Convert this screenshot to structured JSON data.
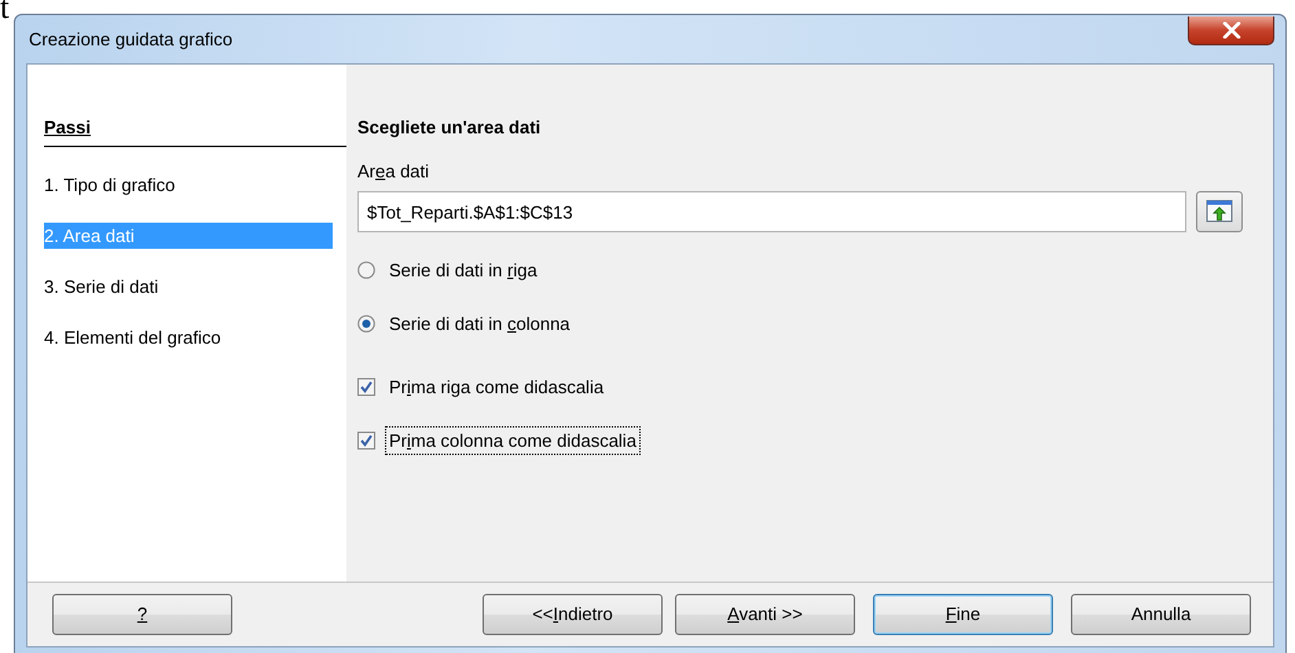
{
  "stray_text": "t",
  "window": {
    "title": "Creazione guidata grafico"
  },
  "steps": {
    "heading": "Passi",
    "items": [
      {
        "label": "1. Tipo di grafico",
        "selected": false
      },
      {
        "label": "2. Area dati",
        "selected": true
      },
      {
        "label": "3. Serie di dati",
        "selected": false
      },
      {
        "label": "4. Elementi del grafico",
        "selected": false
      }
    ]
  },
  "page": {
    "heading": "Scegliete un'area dati",
    "range_label": {
      "before": "Ar",
      "key": "e",
      "after": "a dati"
    },
    "range_value": "$Tot_Reparti.$A$1:$C$13",
    "options": [
      {
        "kind": "radio",
        "parts": {
          "before": "Serie di dati in ",
          "key": "r",
          "after": "iga"
        },
        "checked": false,
        "focused": false
      },
      {
        "kind": "radio",
        "parts": {
          "before": "Serie di dati in ",
          "key": "c",
          "after": "olonna"
        },
        "checked": true,
        "focused": false
      },
      {
        "kind": "checkbox",
        "parts": {
          "before": "Pr",
          "key": "i",
          "after": "ma riga come didascalia"
        },
        "checked": true,
        "focused": false
      },
      {
        "kind": "checkbox",
        "parts": {
          "before": "Pr",
          "key": "i",
          "after": "ma colonna come didascalia"
        },
        "checked": true,
        "focused": true
      }
    ]
  },
  "buttons": [
    {
      "parts": {
        "key": "?"
      },
      "default": false
    },
    {
      "parts": {
        "before": "<<",
        "key": "I",
        "after": "ndietro"
      },
      "default": false
    },
    {
      "parts": {
        "key": "A",
        "after": "vanti >>"
      },
      "default": false
    },
    {
      "parts": {
        "key": "F",
        "after": "ine"
      },
      "default": true
    },
    {
      "parts": {
        "after": "Annulla"
      },
      "default": false
    }
  ]
}
